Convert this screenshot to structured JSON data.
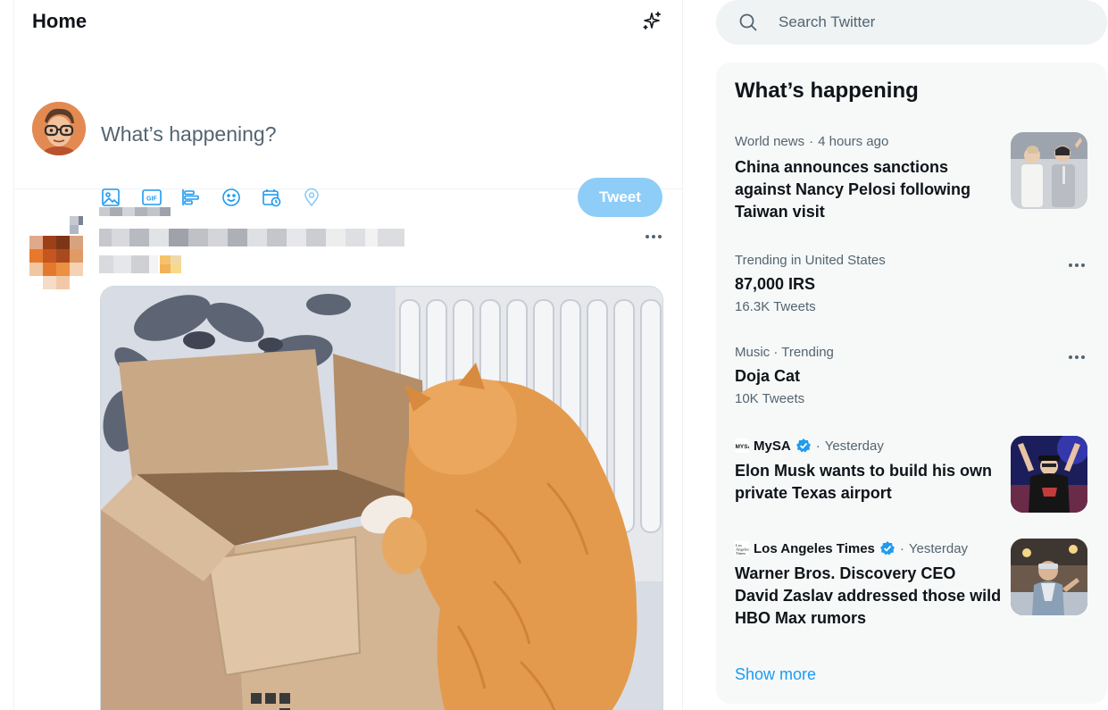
{
  "header": {
    "title": "Home",
    "sparkle_icon": "sparkle-icon"
  },
  "composer": {
    "placeholder": "What’s happening?",
    "tools": [
      "image-icon",
      "gif-icon",
      "poll-icon",
      "emoji-icon",
      "schedule-icon",
      "location-icon"
    ],
    "tweet_label": "Tweet",
    "accent": "#1d9bf0",
    "disabled_button_color": "#8ecdf8"
  },
  "search": {
    "placeholder": "Search Twitter"
  },
  "trends": {
    "title": "What’s happening",
    "items": [
      {
        "category": "World news",
        "time": "4 hours ago",
        "headline": "China announces sanctions against Nancy Pelosi following Taiwan visit",
        "thumb": "news-photo"
      },
      {
        "category": "Trending in United States",
        "headline": "87,000 IRS",
        "count": "16.3K Tweets"
      },
      {
        "category": "Music · Trending",
        "headline": "Doja Cat",
        "count": "10K Tweets"
      },
      {
        "source": "MySA",
        "time": "Yesterday",
        "headline": "Elon Musk wants to build his own private Texas airport",
        "thumb": "musk-photo"
      },
      {
        "source": "Los Angeles Times",
        "time": "Yesterday",
        "headline": "Warner Bros. Discovery CEO David Zaslav addressed those wild HBO Max rumors",
        "thumb": "zaslav-photo"
      }
    ],
    "show_more": "Show more"
  },
  "separator": "·"
}
